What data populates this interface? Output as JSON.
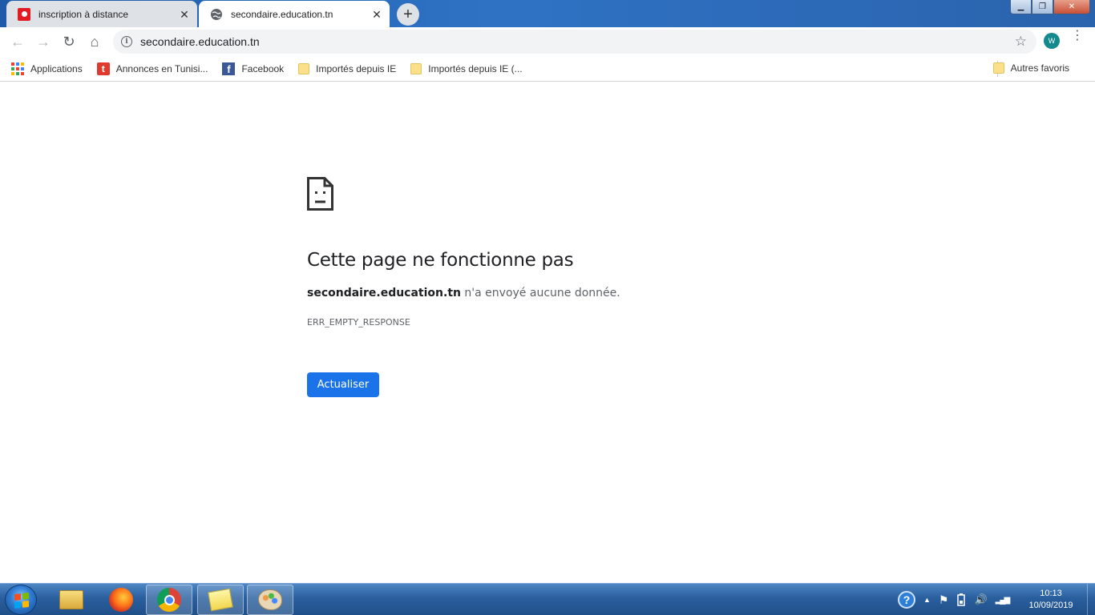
{
  "browser": {
    "tabs": [
      {
        "title": "inscription à distance",
        "active": false
      },
      {
        "title": "secondaire.education.tn",
        "active": true
      }
    ],
    "new_tab_symbol": "+",
    "tab_close_symbol": "✕",
    "window_controls": {
      "minimize": "▁",
      "restore": "❐",
      "close": "✕"
    },
    "nav": {
      "back": "←",
      "forward": "→",
      "reload": "↻",
      "home": "⌂"
    },
    "url": "secondaire.education.tn",
    "star_symbol": "☆",
    "profile_initial": "W",
    "menu_symbol": "⋮"
  },
  "bookmarks": {
    "items": [
      {
        "label": "Applications",
        "icon": "apps-grid-icon"
      },
      {
        "label": "Annonces en Tunisi...",
        "icon": "tayara-icon",
        "glyph": "t"
      },
      {
        "label": "Facebook",
        "icon": "facebook-icon",
        "glyph": "f"
      },
      {
        "label": "Importés depuis IE",
        "icon": "folder-icon"
      },
      {
        "label": "Importés depuis IE (...",
        "icon": "folder-icon"
      }
    ],
    "other_label": "Autres favoris"
  },
  "error_page": {
    "title": "Cette page ne fonctionne pas",
    "host": "secondaire.education.tn",
    "message": " n'a envoyé aucune donnée.",
    "code": "ERR_EMPTY_RESPONSE",
    "button_label": "Actualiser"
  },
  "taskbar": {
    "items": [
      "explorer-icon",
      "firefox-icon",
      "chrome-icon",
      "sticky-notes-icon",
      "paint-icon"
    ],
    "tray": {
      "help_glyph": "?",
      "arrow": "▲",
      "flag": "⚑",
      "volume": "🔊",
      "signal": "▂▄▆"
    },
    "time": "10:13",
    "date": "10/09/2019"
  },
  "colors": {
    "accent": "#1a73e8",
    "taskbar": "#2a5f9e"
  }
}
